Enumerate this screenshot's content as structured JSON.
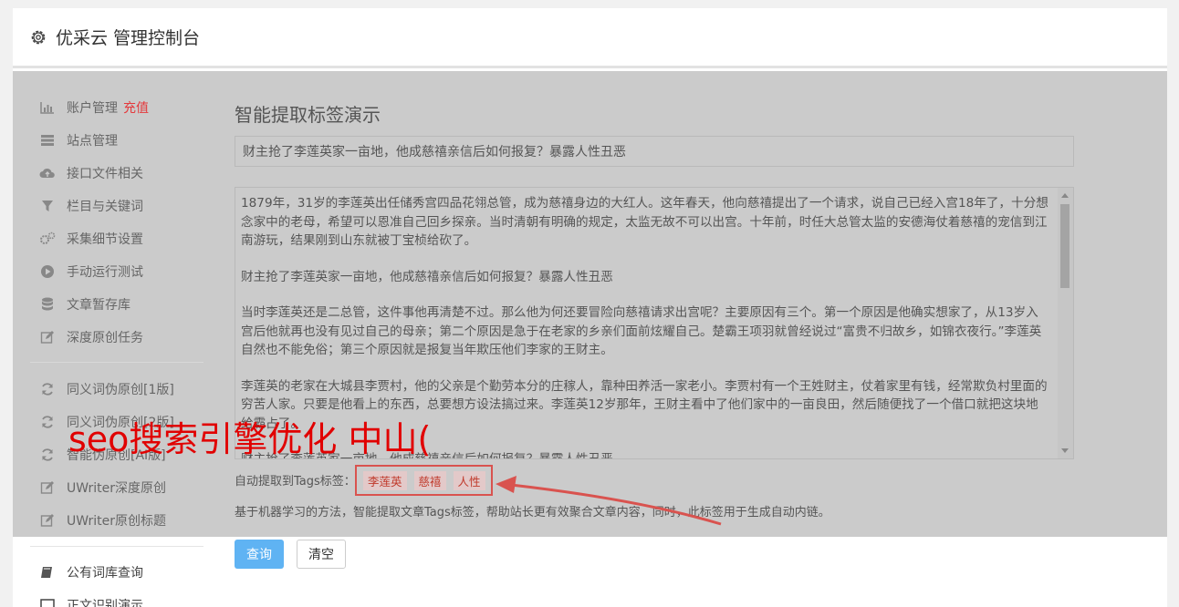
{
  "header": {
    "title": "优采云 管理控制台"
  },
  "sidebar": {
    "items": [
      {
        "label": "账户管理",
        "extra": "充值",
        "icon": "bar-chart-icon"
      },
      {
        "label": "站点管理",
        "icon": "server-icon"
      },
      {
        "label": "接口文件相关",
        "icon": "cloud-upload-icon"
      },
      {
        "label": "栏目与关键词",
        "icon": "filter-icon"
      },
      {
        "label": "采集细节设置",
        "icon": "gears-icon"
      },
      {
        "label": "手动运行测试",
        "icon": "play-circle-icon"
      },
      {
        "label": "文章暂存库",
        "icon": "database-icon"
      },
      {
        "label": "深度原创任务",
        "icon": "edit-icon"
      },
      {
        "label": "同义词伪原创[1版]",
        "icon": "refresh-icon"
      },
      {
        "label": "同义词伪原创[2版]",
        "icon": "refresh-icon"
      },
      {
        "label": "智能伪原创[AI版]",
        "icon": "refresh-icon"
      },
      {
        "label": "UWriter深度原创",
        "icon": "edit-icon"
      },
      {
        "label": "UWriter原创标题",
        "icon": "edit-icon"
      },
      {
        "label": "公有词库查询",
        "icon": "book-icon"
      },
      {
        "label": "正文识别演示",
        "icon": "window-icon"
      }
    ]
  },
  "main": {
    "title": "智能提取标签演示",
    "title_value": "财主抢了李莲英家一亩地，他成慈禧亲信后如何报复？暴露人性丑恶",
    "article": [
      "1879年，31岁的李莲英出任储秀宫四品花翎总管，成为慈禧身边的大红人。这年春天，他向慈禧提出了一个请求，说自己已经入宫18年了，十分想念家中的老母，希望可以恩准自己回乡探亲。当时清朝有明确的规定，太监无故不可以出宫。十年前，时任大总管太监的安德海仗着慈禧的宠信到江南游玩，结果刚到山东就被丁宝桢给砍了。",
      "财主抢了李莲英家一亩地，他成慈禧亲信后如何报复？暴露人性丑恶",
      "当时李莲英还是二总管，这件事他再清楚不过。那么他为何还要冒险向慈禧请求出宫呢？主要原因有三个。第一个原因是他确实想家了，从13岁入宫后他就再也没有见过自己的母亲；第二个原因是急于在老家的乡亲们面前炫耀自己。楚霸王项羽就曾经说过“富贵不归故乡，如锦衣夜行。”李莲英自然也不能免俗；第三个原因就是报复当年欺压他们李家的王财主。",
      "李莲英的老家在大城县李贾村，他的父亲是个勤劳本分的庄稼人，靠种田养活一家老小。李贾村有一个王姓财主，仗着家里有钱，经常欺负村里面的穷苦人家。只要是他看上的东西，总要想方设法搞过来。李莲英12岁那年，王财主看中了他们家中的一亩良田，然后随便找了一个借口就把这块地给霸占了。",
      "财主抢了李莲英家一亩地，他成慈禧亲信后如何报复？暴露人性丑恶"
    ],
    "tags_label": "自动提取到Tags标签：",
    "tags": [
      "李莲英",
      "慈禧",
      "人性"
    ],
    "description": "基于机器学习的方法，智能提取文章Tags标签，帮助站长更有效聚合文章内容，同时，此标签用于生成自动内链。",
    "query_button": "查询",
    "clear_button": "清空"
  },
  "watermark": "seo搜索引擎优化 中山(",
  "colors": {
    "overlay": "#cbcbcb",
    "accent": "#5fb3f3",
    "annotation": "#d9534f",
    "watermark": "#e10000"
  }
}
